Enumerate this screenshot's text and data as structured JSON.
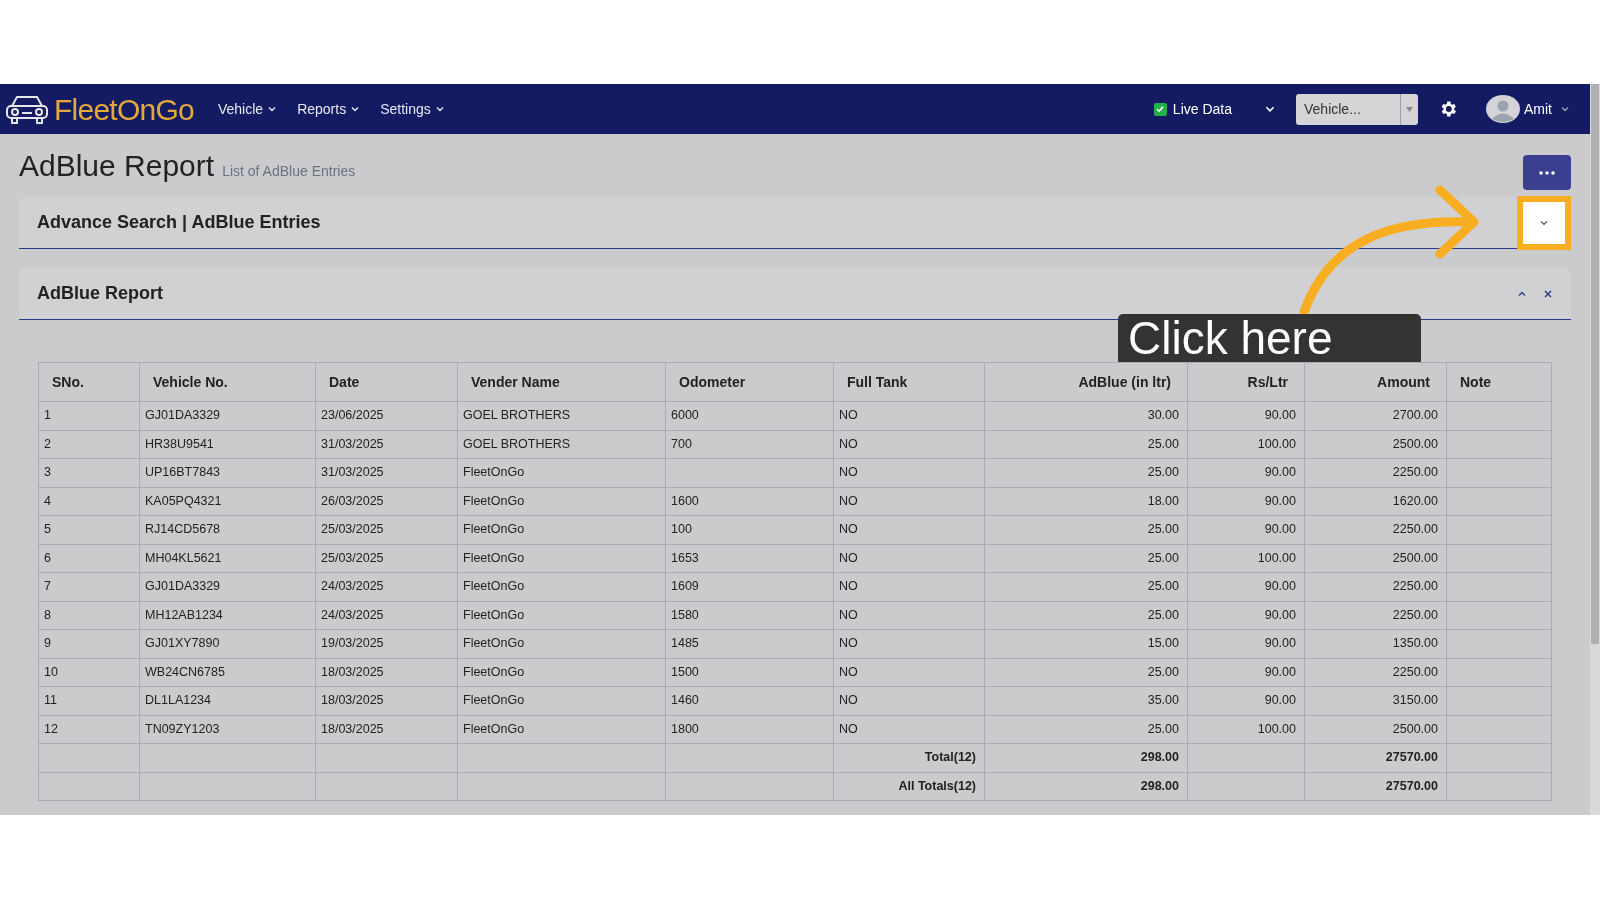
{
  "navbar": {
    "brand": "FleetOnGo",
    "menus": [
      "Vehicle",
      "Reports",
      "Settings"
    ],
    "live_data": {
      "label": "Live Data",
      "checked": true
    },
    "vehicle_select": {
      "placeholder": "Vehicle..."
    },
    "user": "Amit"
  },
  "page": {
    "title": "AdBlue Report",
    "subtitle": "List of AdBlue Entries"
  },
  "advance_search": {
    "title": "Advance Search | AdBlue Entries"
  },
  "report": {
    "title": "AdBlue Report",
    "table": {
      "columns": [
        "SNo.",
        "Vehicle No.",
        "Date",
        "Vender Name",
        "Odometer",
        "Full Tank",
        "AdBlue (in ltr)",
        "Rs/Ltr",
        "Amount",
        "Note"
      ],
      "rows": [
        [
          "1",
          "GJ01DA3329",
          "23/06/2025",
          "GOEL BROTHERS",
          "6000",
          "NO",
          "30.00",
          "90.00",
          "2700.00",
          ""
        ],
        [
          "2",
          "HR38U9541",
          "31/03/2025",
          "GOEL BROTHERS",
          "700",
          "NO",
          "25.00",
          "100.00",
          "2500.00",
          ""
        ],
        [
          "3",
          "UP16BT7843",
          "31/03/2025",
          "FleetOnGo",
          "",
          "NO",
          "25.00",
          "90.00",
          "2250.00",
          ""
        ],
        [
          "4",
          "KA05PQ4321",
          "26/03/2025",
          "FleetOnGo",
          "1600",
          "NO",
          "18.00",
          "90.00",
          "1620.00",
          ""
        ],
        [
          "5",
          "RJ14CD5678",
          "25/03/2025",
          "FleetOnGo",
          "100",
          "NO",
          "25.00",
          "90.00",
          "2250.00",
          ""
        ],
        [
          "6",
          "MH04KL5621",
          "25/03/2025",
          "FleetOnGo",
          "1653",
          "NO",
          "25.00",
          "100.00",
          "2500.00",
          ""
        ],
        [
          "7",
          "GJ01DA3329",
          "24/03/2025",
          "FleetOnGo",
          "1609",
          "NO",
          "25.00",
          "90.00",
          "2250.00",
          ""
        ],
        [
          "8",
          "MH12AB1234",
          "24/03/2025",
          "FleetOnGo",
          "1580",
          "NO",
          "25.00",
          "90.00",
          "2250.00",
          ""
        ],
        [
          "9",
          "GJ01XY7890",
          "19/03/2025",
          "FleetOnGo",
          "1485",
          "NO",
          "15.00",
          "90.00",
          "1350.00",
          ""
        ],
        [
          "10",
          "WB24CN6785",
          "18/03/2025",
          "FleetOnGo",
          "1500",
          "NO",
          "25.00",
          "90.00",
          "2250.00",
          ""
        ],
        [
          "11",
          "DL1LA1234",
          "18/03/2025",
          "FleetOnGo",
          "1460",
          "NO",
          "35.00",
          "90.00",
          "3150.00",
          ""
        ],
        [
          "12",
          "TN09ZY1203",
          "18/03/2025",
          "FleetOnGo",
          "1800",
          "NO",
          "25.00",
          "100.00",
          "2500.00",
          ""
        ]
      ],
      "totals": [
        {
          "label": "Total(12)",
          "adblue": "298.00",
          "amount": "27570.00"
        },
        {
          "label": "All Totals(12)",
          "adblue": "298.00",
          "amount": "27570.00"
        }
      ]
    }
  },
  "callout": {
    "text": "Click here"
  }
}
